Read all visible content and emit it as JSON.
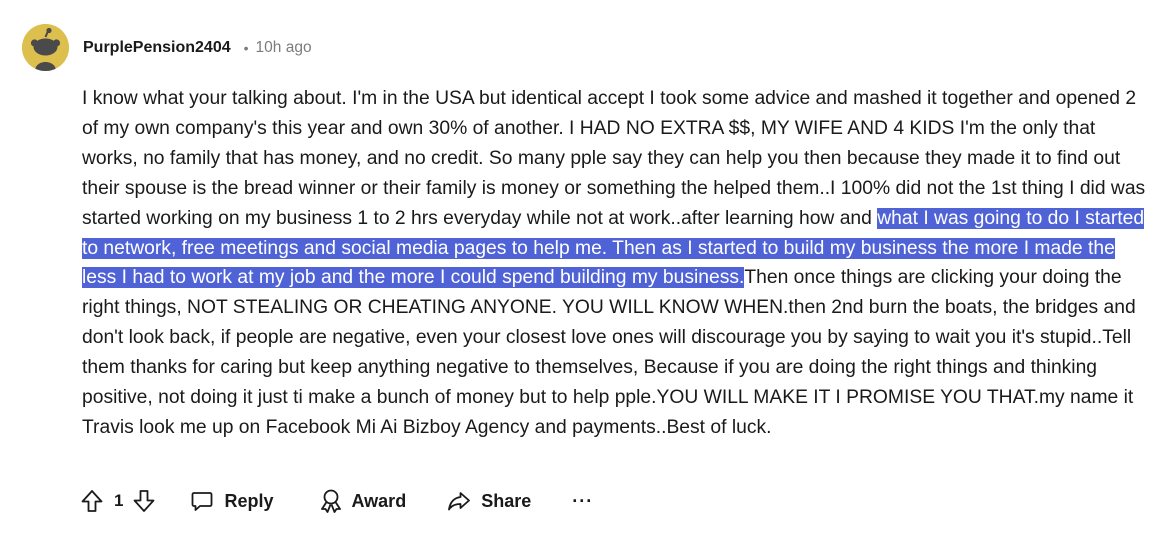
{
  "comment": {
    "username": "PurplePension2404",
    "separator": "•",
    "timestamp": "10h ago",
    "text_before": "I know what your talking about. I'm in the USA but identical accept I took some advice and mashed it together and opened 2 of my own company's this year and own 30% of another. I HAD NO EXTRA $$, MY WIFE AND 4 KIDS I'm the only that works, no family that has money, and no credit. So many pple say they can help you then because they made it to find out their spouse is the bread winner or their family is money or something the helped them..I 100% did not the 1st thing I did was started working on my business 1 to 2 hrs everyday while not at work..after learning how and ",
    "text_highlighted": "what I was going to do I started to network, free meetings and social media pages to help me. Then as I started to build my business the more I made the less I had to work at my job and the more I could spend building my business.",
    "text_after": "Then once things are clicking your doing the right things, NOT STEALING OR CHEATING ANYONE. YOU WILL KNOW WHEN.then 2nd burn the boats, the bridges and don't look back, if people are negative, even your closest love ones will discourage you by saying to wait you it's stupid..Tell them thanks for caring but keep anything negative to themselves, Because if you are doing the right things and thinking positive, not doing it just ti make a bunch of money but to help pple.YOU WILL MAKE IT I PROMISE YOU THAT.my name it Travis look me up on Facebook Mi Ai Bizboy Agency and payments..Best of luck."
  },
  "actions": {
    "upvote_icon": "upvote-arrow-icon",
    "vote_count": "1",
    "downvote_icon": "downvote-arrow-icon",
    "reply_label": "Reply",
    "reply_icon": "speech-bubble-icon",
    "award_label": "Award",
    "award_icon": "award-ribbon-icon",
    "share_label": "Share",
    "share_icon": "share-arrow-icon",
    "more_label": "···"
  },
  "colors": {
    "highlight": "#5063d6",
    "avatar_bg": "#ddbf4e",
    "muted": "#7c7c7c"
  }
}
